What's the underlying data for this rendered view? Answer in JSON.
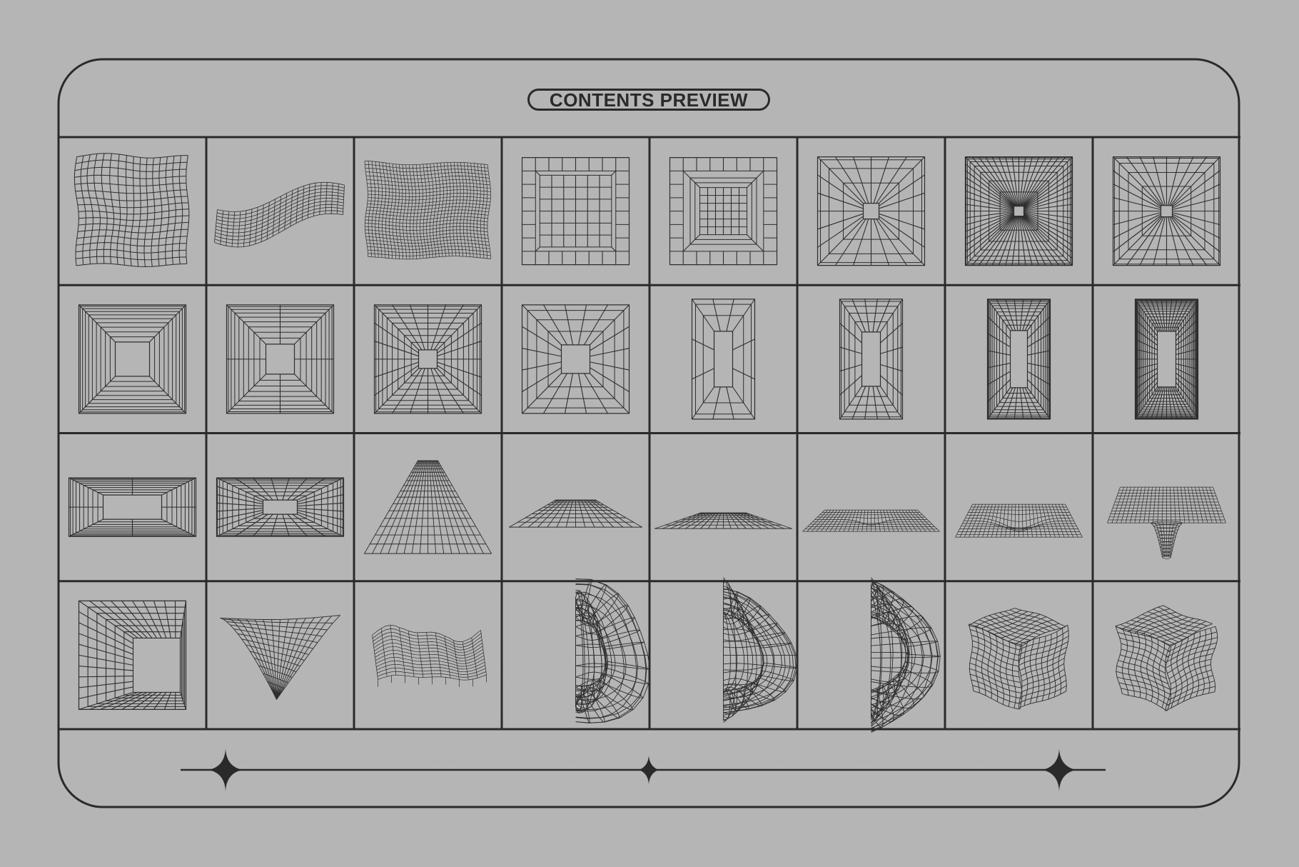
{
  "header": {
    "title": "CONTENTS PREVIEW"
  },
  "palette": {
    "background": "#b5b5b5",
    "ink": "#2a2a2a",
    "wire": "#2e2e2e"
  },
  "grid": {
    "rows": 4,
    "columns": 8
  },
  "cells": [
    {
      "row": 1,
      "col": 1,
      "name": "distorted-grid-square",
      "kind": "warpgrid",
      "variant": "square"
    },
    {
      "row": 1,
      "col": 2,
      "name": "wavy-ribbon-mesh",
      "kind": "ribbon"
    },
    {
      "row": 1,
      "col": 3,
      "name": "bumpy-dense-grid",
      "kind": "warpgrid",
      "variant": "dense"
    },
    {
      "row": 1,
      "col": 4,
      "name": "shallow-box-grid",
      "kind": "tunnel",
      "variant": "shallow-box"
    },
    {
      "row": 1,
      "col": 5,
      "name": "deep-box-grid",
      "kind": "tunnel",
      "variant": "deep-box"
    },
    {
      "row": 1,
      "col": 6,
      "name": "radial-tunnel-sparse",
      "kind": "tunnel",
      "variant": "radial-sparse"
    },
    {
      "row": 1,
      "col": 7,
      "name": "radial-tunnel-dense",
      "kind": "tunnel",
      "variant": "radial-dense"
    },
    {
      "row": 1,
      "col": 8,
      "name": "radial-tunnel-medium",
      "kind": "tunnel",
      "variant": "radial-medium"
    },
    {
      "row": 2,
      "col": 1,
      "name": "square-tunnel-rings",
      "kind": "tunnel",
      "variant": "rings"
    },
    {
      "row": 2,
      "col": 2,
      "name": "square-tunnel-rings-cross",
      "kind": "tunnel",
      "variant": "rings-cross"
    },
    {
      "row": 2,
      "col": 3,
      "name": "square-tunnel-grid",
      "kind": "tunnel",
      "variant": "grid"
    },
    {
      "row": 2,
      "col": 4,
      "name": "square-tunnel-sparse",
      "kind": "tunnel",
      "variant": "sparse"
    },
    {
      "row": 2,
      "col": 5,
      "name": "tall-tunnel-sparse",
      "kind": "tunnel",
      "variant": "tall-sparse"
    },
    {
      "row": 2,
      "col": 6,
      "name": "tall-tunnel-medium",
      "kind": "tunnel",
      "variant": "tall-medium"
    },
    {
      "row": 2,
      "col": 7,
      "name": "tall-tunnel-grid",
      "kind": "tunnel",
      "variant": "tall-grid"
    },
    {
      "row": 2,
      "col": 8,
      "name": "tall-tunnel-dense",
      "kind": "tunnel",
      "variant": "tall-dense"
    },
    {
      "row": 3,
      "col": 1,
      "name": "wide-tunnel-rings",
      "kind": "tunnel",
      "variant": "wide-rings"
    },
    {
      "row": 3,
      "col": 2,
      "name": "wide-tunnel-grid",
      "kind": "tunnel",
      "variant": "wide-grid"
    },
    {
      "row": 3,
      "col": 3,
      "name": "perspective-floor-tall",
      "kind": "floor",
      "variant": "tall"
    },
    {
      "row": 3,
      "col": 4,
      "name": "perspective-floor-medium",
      "kind": "floor",
      "variant": "medium"
    },
    {
      "row": 3,
      "col": 5,
      "name": "perspective-floor-flat",
      "kind": "floor",
      "variant": "flat"
    },
    {
      "row": 3,
      "col": 6,
      "name": "plane-shallow-dip",
      "kind": "plane",
      "variant": "small-dip"
    },
    {
      "row": 3,
      "col": 7,
      "name": "plane-wave-dip",
      "kind": "plane",
      "variant": "wave"
    },
    {
      "row": 3,
      "col": 8,
      "name": "plane-deep-well",
      "kind": "plane",
      "variant": "well"
    },
    {
      "row": 4,
      "col": 1,
      "name": "room-corner-grid",
      "kind": "room"
    },
    {
      "row": 4,
      "col": 2,
      "name": "curved-cone-surface",
      "kind": "cone"
    },
    {
      "row": 4,
      "col": 3,
      "name": "terrain-steps",
      "kind": "terrain"
    },
    {
      "row": 4,
      "col": 4,
      "name": "blob-mesh-one",
      "kind": "blob",
      "variant": 1
    },
    {
      "row": 4,
      "col": 5,
      "name": "blob-mesh-two",
      "kind": "blob",
      "variant": 2
    },
    {
      "row": 4,
      "col": 6,
      "name": "blob-mesh-three",
      "kind": "blob",
      "variant": 3
    },
    {
      "row": 4,
      "col": 7,
      "name": "warped-cube-one",
      "kind": "cube",
      "variant": 1
    },
    {
      "row": 4,
      "col": 8,
      "name": "warped-cube-two",
      "kind": "cube",
      "variant": 2
    }
  ],
  "footer": {
    "ornament": "line-with-stars",
    "stars": [
      "large-star",
      "small-star",
      "large-star"
    ]
  }
}
